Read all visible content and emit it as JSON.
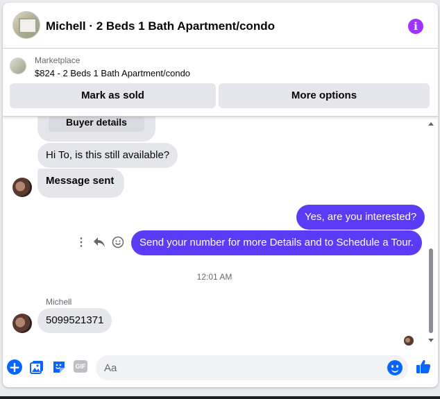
{
  "header": {
    "title": "Michell · 2 Beds 1 Bath Apartment/condo",
    "info_icon": "info-icon",
    "accent_color": "#a033ff"
  },
  "listing": {
    "source": "Marketplace",
    "title": "$824 - 2 Beds 1 Bath Apartment/condo",
    "mark_sold_label": "Mark as sold",
    "more_options_label": "More options"
  },
  "thread": {
    "card_button_label": "Buyer details",
    "messages": [
      {
        "direction": "incoming",
        "text": "Hi To, is this still available?"
      },
      {
        "direction": "incoming",
        "text": "Message sent"
      },
      {
        "direction": "outgoing",
        "text": "Yes, are you interested?"
      },
      {
        "direction": "outgoing",
        "text": "Send your number for more Details and to Schedule a Tour."
      }
    ],
    "timestamp": "12:01 AM",
    "reply_sender": "Michell",
    "reply_text": "5099521371",
    "outgoing_color": "#5b3bf5",
    "incoming_color": "#e4e6eb"
  },
  "message_actions": {
    "more_icon": "more-vertical-icon",
    "reply_icon": "reply-icon",
    "react_icon": "smiley-icon"
  },
  "composer": {
    "placeholder": "Aa",
    "value": "",
    "icons": [
      "plus-icon",
      "photo-icon",
      "sticker-icon",
      "gif-icon",
      "emoji-icon",
      "like-icon"
    ],
    "gif_label": "GIF",
    "accent_color": "#0866ff"
  }
}
